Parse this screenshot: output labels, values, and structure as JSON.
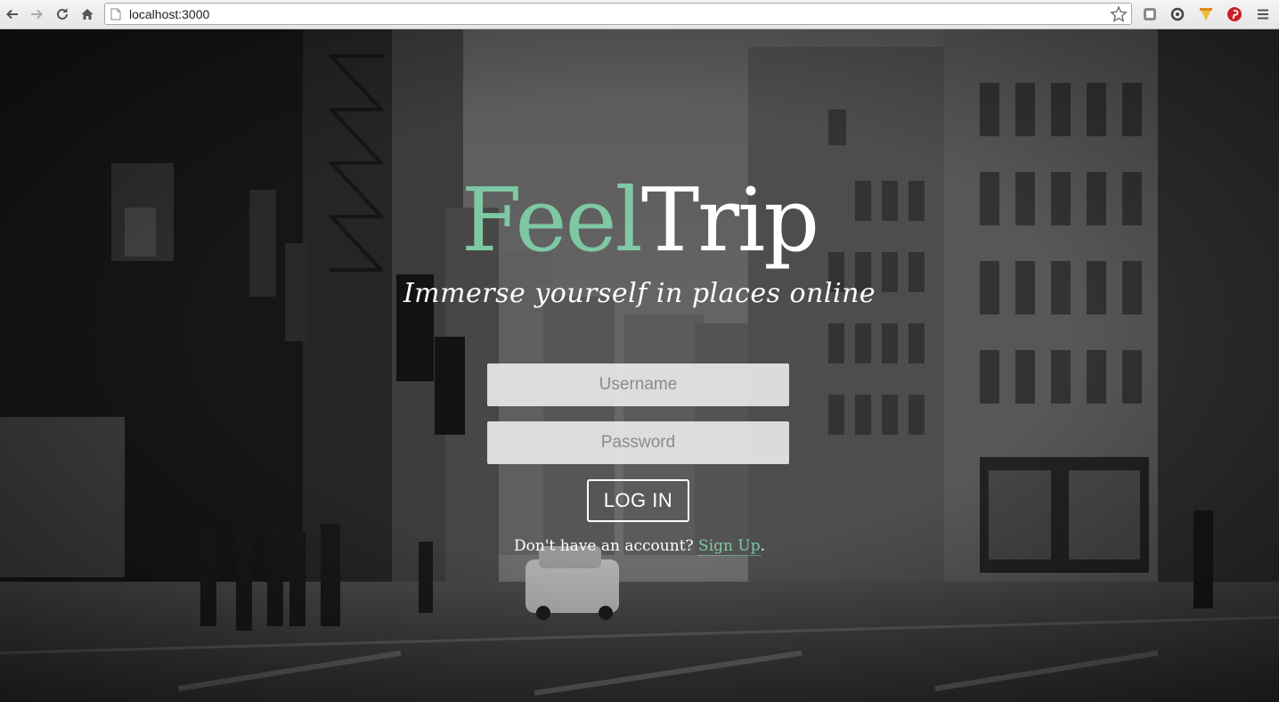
{
  "browser": {
    "url": "localhost:3000"
  },
  "brand": {
    "part1": "Feel",
    "part2": "Trip",
    "accent_color": "#7ec8a4"
  },
  "tagline": "Immerse yourself in places online",
  "login_form": {
    "username_placeholder": "Username",
    "password_placeholder": "Password",
    "submit_label": "LOG IN"
  },
  "signup": {
    "prompt": "Don't have an account?",
    "link_label": "Sign Up",
    "suffix": "."
  },
  "icons": {
    "back": "arrow-left-icon",
    "forward": "arrow-right-icon",
    "reload": "reload-icon",
    "home": "home-icon",
    "page": "page-icon",
    "bookmark": "star-icon",
    "extensions": [
      "extension-square-icon",
      "extension-refresh-icon",
      "extension-flag-icon",
      "pinterest-icon"
    ],
    "menu": "hamburger-menu-icon"
  }
}
